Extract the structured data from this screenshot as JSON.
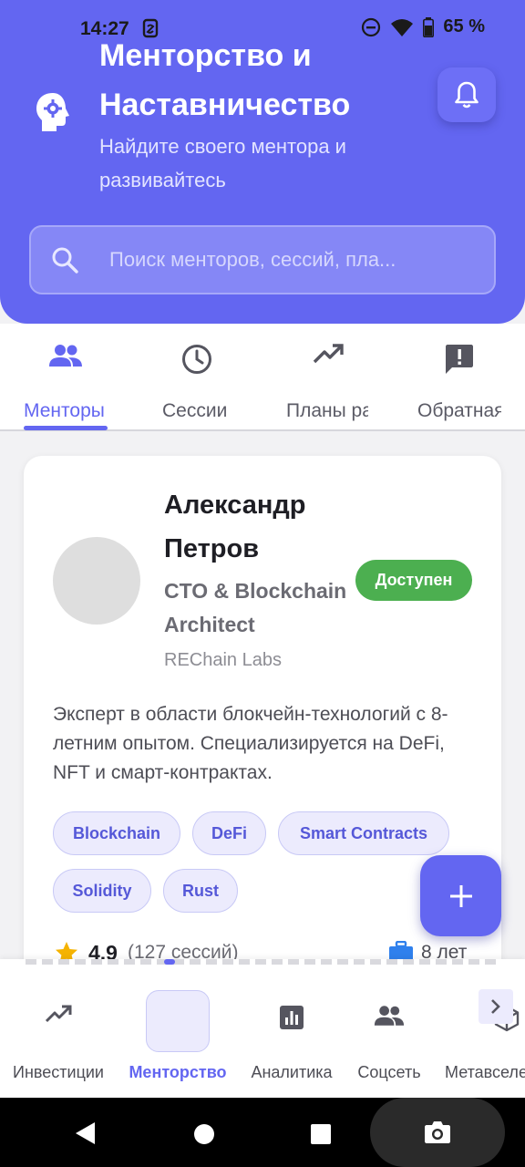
{
  "status_bar": {
    "time": "14:27",
    "battery": "65 %"
  },
  "header": {
    "title": "Менторство и Наставничество",
    "subtitle": "Найдите своего ментора и развивайтесь"
  },
  "search": {
    "placeholder": "Поиск менторов, сессий, пла..."
  },
  "tabs": [
    {
      "label": "Менторы",
      "icon": "people-icon",
      "active": true
    },
    {
      "label": "Сессии",
      "icon": "clock-icon"
    },
    {
      "label": "Планы развития",
      "icon": "trending-up-icon"
    },
    {
      "label": "Обратная связь",
      "icon": "feedback-icon"
    }
  ],
  "mentor": {
    "name": "Александр Петров",
    "role": "CTO & Blockchain Architect",
    "company": "REChain Labs",
    "status": "Доступен",
    "status_color": "#4caf50",
    "description": "Эксперт в области блокчейн-технологий с 8-летним опытом. Специализируется на DeFi, NFT и смарт-контрактах.",
    "tags": [
      "Blockchain",
      "DeFi",
      "Smart Contracts",
      "Solidity",
      "Rust"
    ],
    "rating": "4.9",
    "sessions": "(127 сессий)",
    "experience": "8 лет"
  },
  "bottom_nav": [
    {
      "label": "Инвестиции",
      "icon": "trending-up-icon"
    },
    {
      "label": "Менторство",
      "icon": "brain-icon",
      "active": true
    },
    {
      "label": "Аналитика",
      "icon": "bar-chart-icon"
    },
    {
      "label": "Соцсеть",
      "icon": "people-icon"
    },
    {
      "label": "Метавселенная",
      "icon": "cube-icon"
    }
  ],
  "colors": {
    "primary": "#6366f1",
    "available": "#4caf50"
  }
}
